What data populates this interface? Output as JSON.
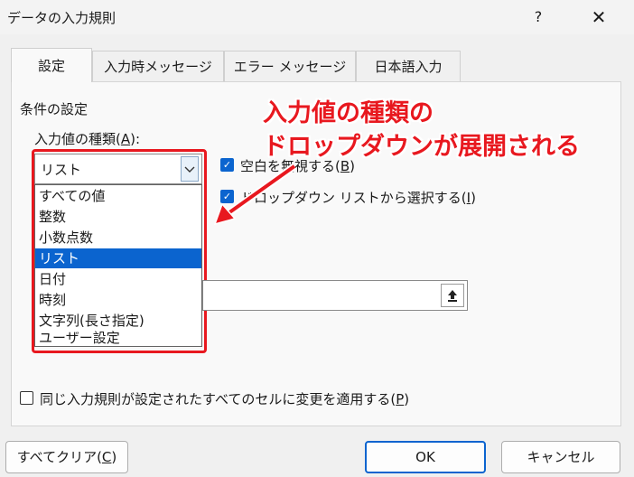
{
  "window": {
    "title": "データの入力規則",
    "help": "?",
    "close": "✕"
  },
  "tabs": [
    {
      "label": "設定"
    },
    {
      "label": "入力時メッセージ"
    },
    {
      "label": "エラー メッセージ"
    },
    {
      "label": "日本語入力"
    }
  ],
  "settings": {
    "section_label": "条件の設定",
    "allow_label": "入力値の種類(",
    "allow_label_key": "A",
    "allow_label_end": "):",
    "allow_value": "リスト",
    "dropdown_options": [
      {
        "label": "すべての値"
      },
      {
        "label": "整数"
      },
      {
        "label": "小数点数"
      },
      {
        "label": "リスト"
      },
      {
        "label": "日付"
      },
      {
        "label": "時刻"
      },
      {
        "label": "文字列(長さ指定)"
      },
      {
        "label": "ユーザー設定"
      }
    ],
    "selected_option": "リスト",
    "ignore_blank": {
      "label": "空白を無視する(",
      "key": "B",
      "end": ")",
      "checked": true
    },
    "in_cell_dropdown": {
      "label": "ドロップダウン リストから選択する(",
      "key": "I",
      "end": ")",
      "checked": true
    },
    "apply_all": {
      "label": "同じ入力規則が設定されたすべてのセルに変更を適用する(",
      "key": "P",
      "end": ")",
      "checked": false
    }
  },
  "annotation": {
    "line1": "入力値の種類の",
    "line2": "ドロップダウンが展開される",
    "color": "#e8181f"
  },
  "buttons": {
    "clear_all": "すべてクリア(",
    "clear_all_key": "C",
    "clear_all_end": ")",
    "ok": "OK",
    "cancel": "キャンセル"
  },
  "colors": {
    "accent": "#0b64cf",
    "highlight": "#e8181f"
  }
}
